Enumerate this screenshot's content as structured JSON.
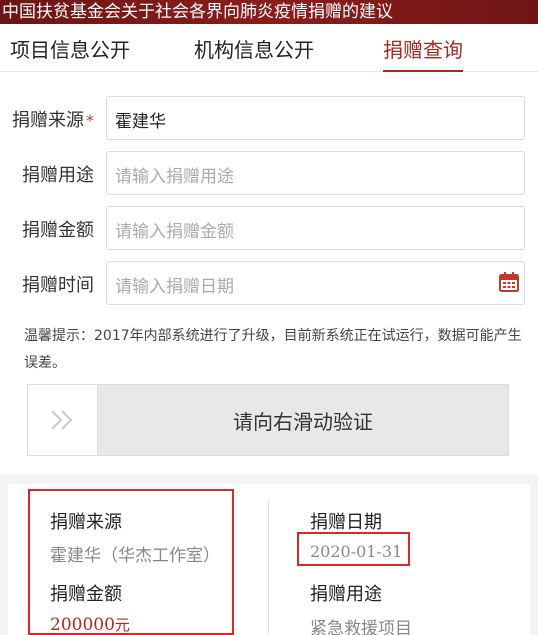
{
  "banner": {
    "title": "中国扶贫基金会关于社会各界向肺炎疫情捐赠的建议"
  },
  "tabs": [
    {
      "label": "项目信息公开"
    },
    {
      "label": "机构信息公开"
    },
    {
      "label": "捐赠查询",
      "active": true
    }
  ],
  "form": {
    "source": {
      "label": "捐赠来源",
      "required_mark": "*",
      "value": "霍建华"
    },
    "purpose": {
      "label": "捐赠用途",
      "placeholder": "请输入捐赠用途"
    },
    "amount": {
      "label": "捐赠金额",
      "placeholder": "请输入捐赠金额"
    },
    "date": {
      "label": "捐赠时间",
      "placeholder": "请输入捐赠日期",
      "icon": "calendar-icon"
    }
  },
  "tip": "温馨提示：2017年内部系统进行了升级，目前新系统正在试运行，数据可能产生误差。",
  "slider": {
    "text": "请向右滑动验证",
    "handle_icon": "double-chevron-right-icon"
  },
  "result": {
    "source_label": "捐赠来源",
    "source_value": "霍建华（华杰工作室）",
    "amount_label": "捐赠金额",
    "amount_value": "200000",
    "amount_unit": "元",
    "date_label": "捐赠日期",
    "date_value": "2020-01-31",
    "purpose_label": "捐赠用途",
    "purpose_value": "紧急救援项目"
  },
  "colors": {
    "accent": "#a32a1f",
    "banner": "#7a1818",
    "highlight_box": "#e0262a"
  }
}
